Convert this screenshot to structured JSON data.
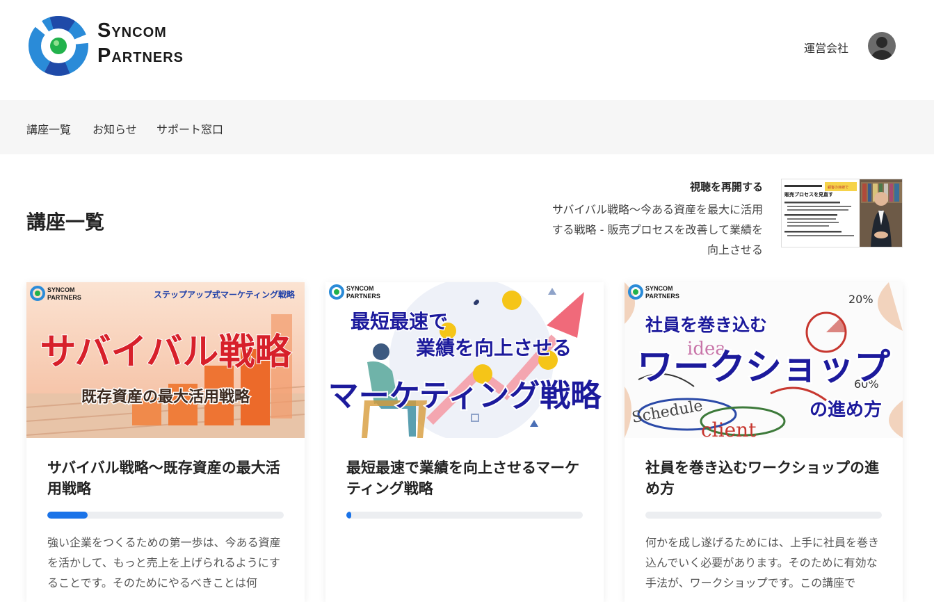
{
  "brand": {
    "logo_line1": "Syncom",
    "logo_line2": "Partners"
  },
  "header": {
    "company_link": "運営会社"
  },
  "nav": {
    "items": [
      {
        "label": "講座一覧"
      },
      {
        "label": "お知らせ"
      },
      {
        "label": "サポート窓口"
      }
    ]
  },
  "main": {
    "title": "講座一覧"
  },
  "resume": {
    "label": "視聴を再開する",
    "title": "サバイバル戦略〜今ある資産を最大に活用する戦略 - 販売プロセスを改善して業績を向上させる",
    "thumb_heading": "販売プロセスを見直す",
    "thumb_badge": "顧客の目線で"
  },
  "courses": [
    {
      "title": "サバイバル戦略〜既存資産の最大活用戦略",
      "progress": 0.17,
      "description": "強い企業をつくるための第一歩は、今ある資産を活かして、もっと売上を上げられるようにすることです。そのためにやるべきことは何",
      "image": {
        "brand_line1": "SYNCOM",
        "brand_line2": "PARTNERS",
        "tag": "ステップアップ式マーケティング戦略",
        "headline": "サバイバル戦略",
        "sub": "既存資産の最大活用戦略"
      }
    },
    {
      "title": "最短最速で業績を向上させるマーケティング戦略",
      "progress": 0.02,
      "description": "",
      "image": {
        "brand_line1": "SYNCOM",
        "brand_line2": "PARTNERS",
        "line1": "最短最速で",
        "line2": "業績を向上させる",
        "headline": "マーケティング戦略"
      }
    },
    {
      "title": "社員を巻き込むワークショップの進め方",
      "progress": 0,
      "description": "何かを成し遂げるためには、上手に社員を巻き込んでいく必要があります。そのために有効な手法が、ワークショップです。この講座で",
      "image": {
        "brand_line1": "SYNCOM",
        "brand_line2": "PARTNERS",
        "line1": "社員を巻き込む",
        "headline": "ワークショップ",
        "sub": "の進め方",
        "doodle1": "Schedule",
        "doodle2": "client",
        "doodle3": "idea",
        "doodle4": "20%",
        "doodle5": "60%"
      }
    }
  ],
  "colors": {
    "accent": "#1a73e8",
    "nav_bg": "#f6f6f6",
    "headline_red": "#d7202a",
    "headline_navy": "#1c1a9c"
  }
}
